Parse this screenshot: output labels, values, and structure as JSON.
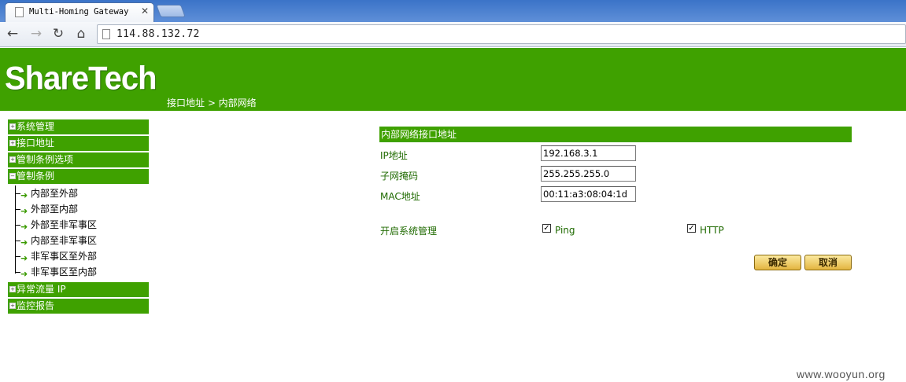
{
  "browser": {
    "tab_title": "Multi-Homing Gateway",
    "tab_close": "✕",
    "url": "114.88.132.72",
    "icons": [
      "back-icon",
      "forward-icon",
      "reload-icon",
      "home-icon",
      "page-icon"
    ]
  },
  "header": {
    "logo": "ShareTech",
    "breadcrumb": "接口地址 > 内部网络"
  },
  "sidebar": {
    "menu_top": [
      "系统管理",
      "接口地址",
      "管制条例选项"
    ],
    "expanded": "管制条例",
    "sub_items": [
      "内部至外部",
      "外部至内部",
      "外部至非军事区",
      "内部至非军事区",
      "非军事区至外部",
      "非军事区至内部"
    ],
    "menu_bottom": [
      "异常流量 IP",
      "监控报告"
    ]
  },
  "form": {
    "title": "内部网络接口地址",
    "ip_label": "IP地址",
    "ip_value": "192.168.3.1",
    "mask_label": "子网掩码",
    "mask_value": "255.255.255.0",
    "mac_label": "MAC地址",
    "mac_value": "00:11:a3:08:04:1d",
    "mgmt_label": "开启系统管理",
    "ping_label": "Ping",
    "ping_checked": true,
    "http_label": "HTTP",
    "http_checked": true
  },
  "buttons": {
    "ok": "确定",
    "cancel": "取消"
  },
  "watermark": "www.wooyun.org",
  "colors": {
    "brand_green": "#3fa100",
    "button_gold": "#e3b540"
  }
}
